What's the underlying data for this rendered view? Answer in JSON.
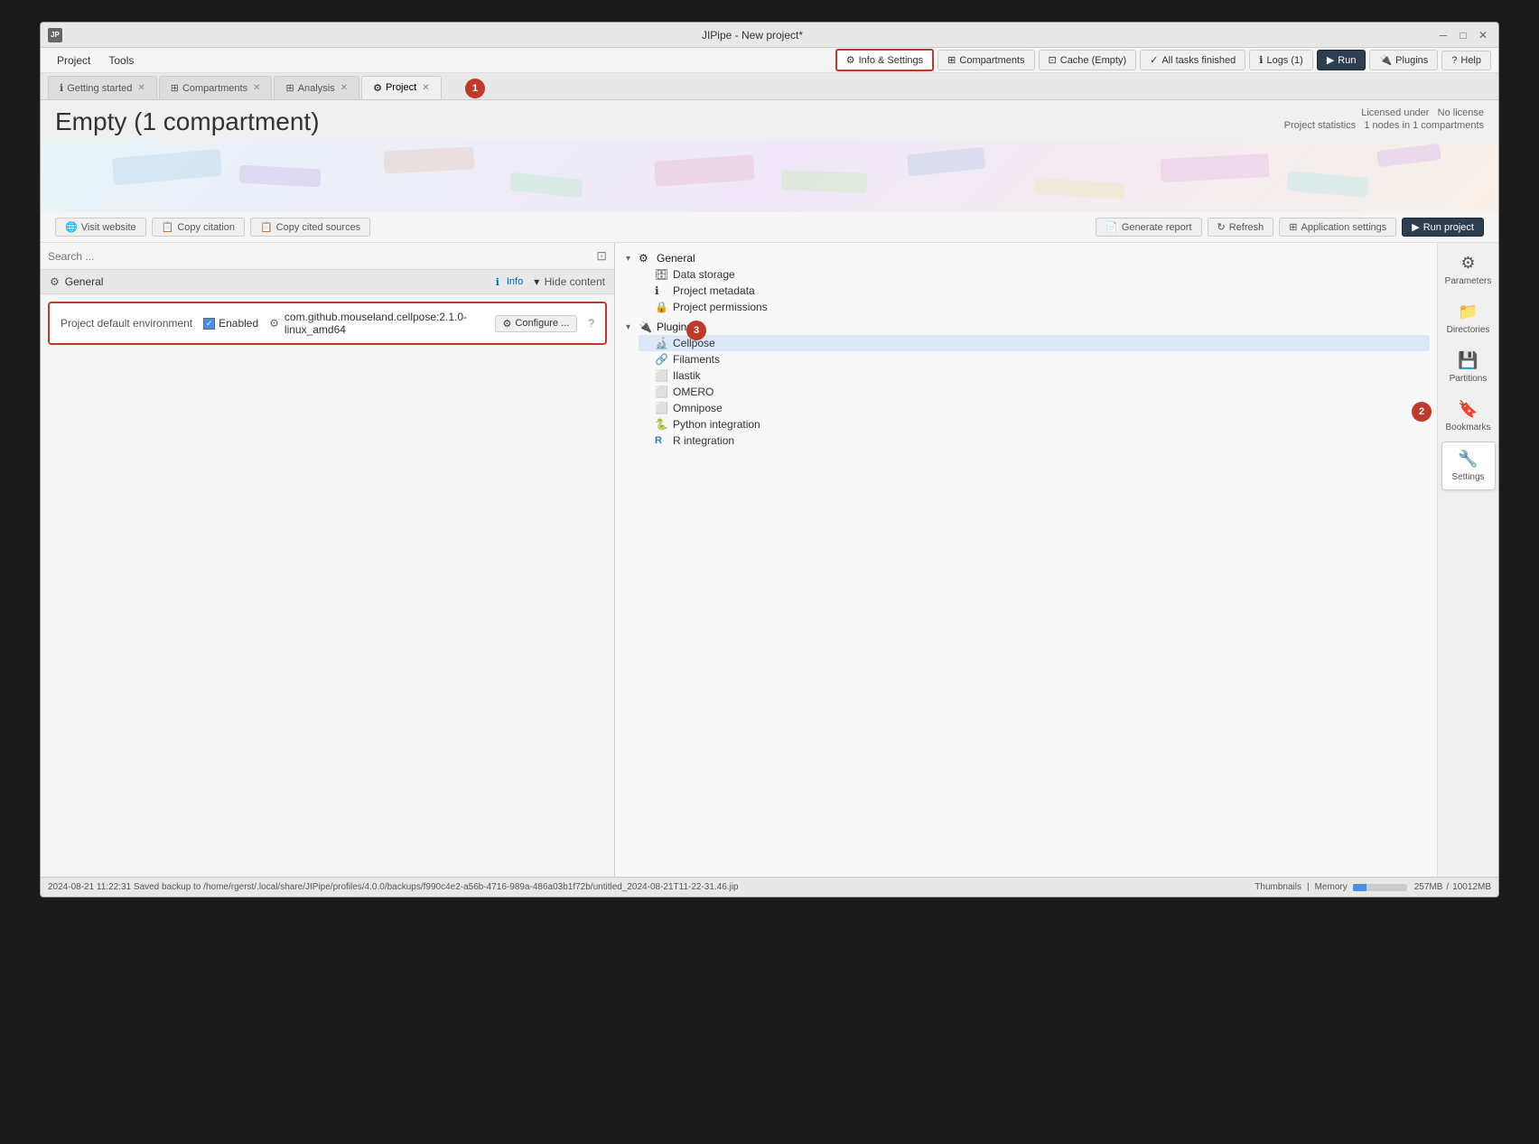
{
  "window": {
    "title": "JIPipe - New project*",
    "logo": "JP"
  },
  "titlebar": {
    "minimize": "─",
    "maximize": "□",
    "close": "✕"
  },
  "menubar": {
    "items": [
      "Project",
      "Tools"
    ]
  },
  "toolbar": {
    "info_settings": "Info & Settings",
    "compartments": "Compartments",
    "cache": "Cache (Empty)",
    "all_tasks": "All tasks finished",
    "logs": "Logs (1)",
    "run": "Run",
    "plugins": "Plugins",
    "help": "Help"
  },
  "tabs": [
    {
      "label": "Getting started",
      "icon": "ℹ",
      "active": false
    },
    {
      "label": "Compartments",
      "icon": "⊞",
      "active": false
    },
    {
      "label": "Analysis",
      "icon": "⊞",
      "active": false
    },
    {
      "label": "Project",
      "icon": "⚙",
      "active": true
    }
  ],
  "project": {
    "title": "Empty (1 compartment)",
    "license_label": "Licensed under",
    "license_value": "No license",
    "stats_label": "Project statistics",
    "stats_value": "1 nodes in 1 compartments"
  },
  "actions": {
    "visit_website": "Visit website",
    "copy_citation": "Copy citation",
    "copy_cited_sources": "Copy cited sources",
    "generate_report": "Generate report",
    "refresh": "Refresh",
    "application_settings": "Application settings",
    "run_project": "Run project"
  },
  "search": {
    "placeholder": "Search ..."
  },
  "panel": {
    "section_title": "General",
    "info_label": "Info",
    "hide_content": "Hide content",
    "env_label": "Project default environment",
    "enabled": "Enabled",
    "env_path": "com.github.mouseland.cellpose:2.1.0-linux_amd64",
    "configure": "Configure ..."
  },
  "tree": {
    "sections": [
      {
        "label": "General",
        "icon": "⚙",
        "expanded": true,
        "children": [
          {
            "label": "Data storage",
            "icon": "🗄",
            "children": []
          },
          {
            "label": "Project metadata",
            "icon": "ℹ",
            "children": []
          },
          {
            "label": "Project permissions",
            "icon": "🔒",
            "children": []
          }
        ]
      },
      {
        "label": "Plugins",
        "icon": "🔌",
        "expanded": true,
        "children": [
          {
            "label": "Cellpose",
            "icon": "🔬",
            "children": [],
            "selected": true
          },
          {
            "label": "Filaments",
            "icon": "🔗",
            "children": []
          },
          {
            "label": "Ilastik",
            "icon": "⬜",
            "children": []
          },
          {
            "label": "OMERO",
            "icon": "⬜",
            "children": []
          },
          {
            "label": "Omnipose",
            "icon": "⬜",
            "children": []
          },
          {
            "label": "Python integration",
            "icon": "🐍",
            "children": []
          },
          {
            "label": "R integration",
            "icon": "R",
            "children": []
          }
        ]
      }
    ]
  },
  "side_icons": [
    {
      "label": "Parameters",
      "symbol": "⚙"
    },
    {
      "label": "Directories",
      "symbol": "📁"
    },
    {
      "label": "Partitions",
      "symbol": "💾"
    },
    {
      "label": "Bookmarks",
      "symbol": "🔖"
    },
    {
      "label": "Settings",
      "symbol": "🔧",
      "active": true
    }
  ],
  "badges": {
    "b1": "1",
    "b2": "2",
    "b3": "3"
  },
  "statusbar": {
    "message": "2024-08-21 11:22:31 Saved backup to /home/rgerst/.local/share/JIPipe/profiles/4.0.0/backups/f990c4e2-a56b-4716-989a-486a03b1f72b/untitled_2024-08-21T11-22-31.46.jip",
    "thumbnails": "Thumbnails",
    "memory": "Memory",
    "memory_used": "257MB",
    "memory_total": "10012MB"
  },
  "info_popup": {
    "label": "Info"
  }
}
